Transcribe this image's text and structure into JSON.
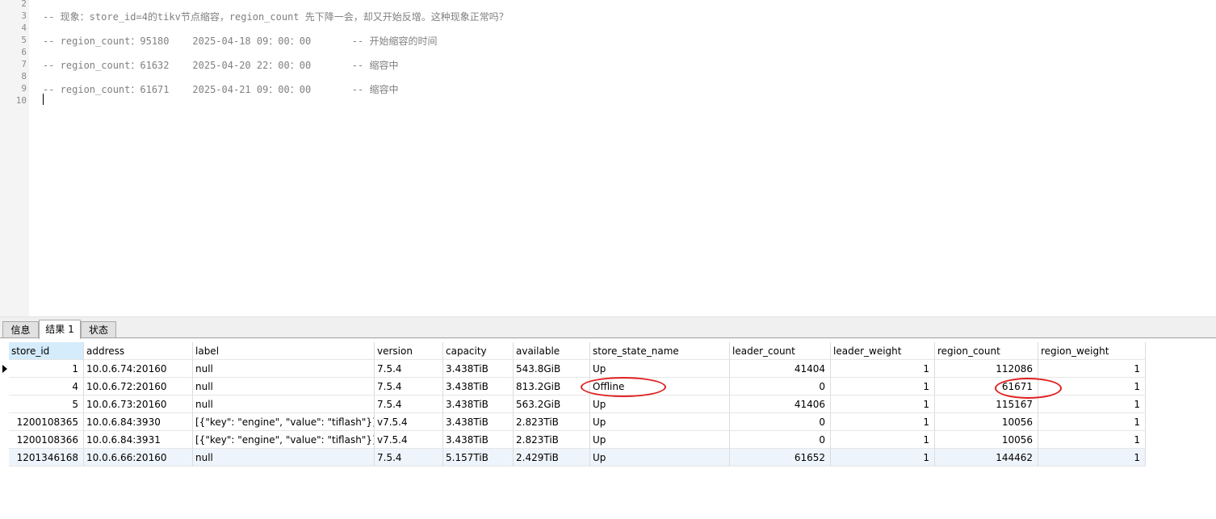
{
  "editor": {
    "line_numbers": [
      "2",
      "3",
      "4",
      "5",
      "6",
      "7",
      "8",
      "9",
      "10"
    ],
    "lines": [
      "",
      "-- 现象：store_id=4的tikv节点缩容，region_count 先下降一会，却又开始反增。这种现象正常吗？",
      "",
      "-- region_count：95180    2025-04-18 09：00：00       -- 开始缩容的时间",
      "",
      "-- region_count：61632    2025-04-20 22：00：00       -- 缩容中",
      "",
      "-- region_count：61671    2025-04-21 09：00：00       -- 缩容中",
      ""
    ]
  },
  "tabs": [
    {
      "label": "信息"
    },
    {
      "label": "结果 1"
    },
    {
      "label": "状态"
    }
  ],
  "active_tab": "结果 1",
  "grid": {
    "columns": [
      "store_id",
      "address",
      "label",
      "version",
      "capacity",
      "available",
      "store_state_name",
      "leader_count",
      "leader_weight",
      "region_count",
      "region_weight"
    ],
    "rows": [
      [
        "1",
        "10.0.6.74:20160",
        "null",
        "7.5.4",
        "3.438TiB",
        "543.8GiB",
        "Up",
        "41404",
        "1",
        "112086",
        "1"
      ],
      [
        "4",
        "10.0.6.72:20160",
        "null",
        "7.5.4",
        "3.438TiB",
        "813.2GiB",
        "Offline",
        "0",
        "1",
        "61671",
        "1"
      ],
      [
        "5",
        "10.0.6.73:20160",
        "null",
        "7.5.4",
        "3.438TiB",
        "563.2GiB",
        "Up",
        "41406",
        "1",
        "115167",
        "1"
      ],
      [
        "1200108365",
        "10.0.6.84:3930",
        "[{\"key\": \"engine\", \"value\": \"tiflash\"}]",
        "v7.5.4",
        "3.438TiB",
        "2.823TiB",
        "Up",
        "0",
        "1",
        "10056",
        "1"
      ],
      [
        "1200108366",
        "10.0.6.84:3931",
        "[{\"key\": \"engine\", \"value\": \"tiflash\"}]",
        "v7.5.4",
        "3.438TiB",
        "2.823TiB",
        "Up",
        "0",
        "1",
        "10056",
        "1"
      ],
      [
        "1201346168",
        "10.0.6.66:20160",
        "null",
        "7.5.4",
        "5.157TiB",
        "2.429TiB",
        "Up",
        "61652",
        "1",
        "144462",
        "1"
      ]
    ]
  },
  "colors": {
    "highlight_circle": "#e02020",
    "sorted_header": "#d4ecfb",
    "comment_text": "#808080"
  }
}
